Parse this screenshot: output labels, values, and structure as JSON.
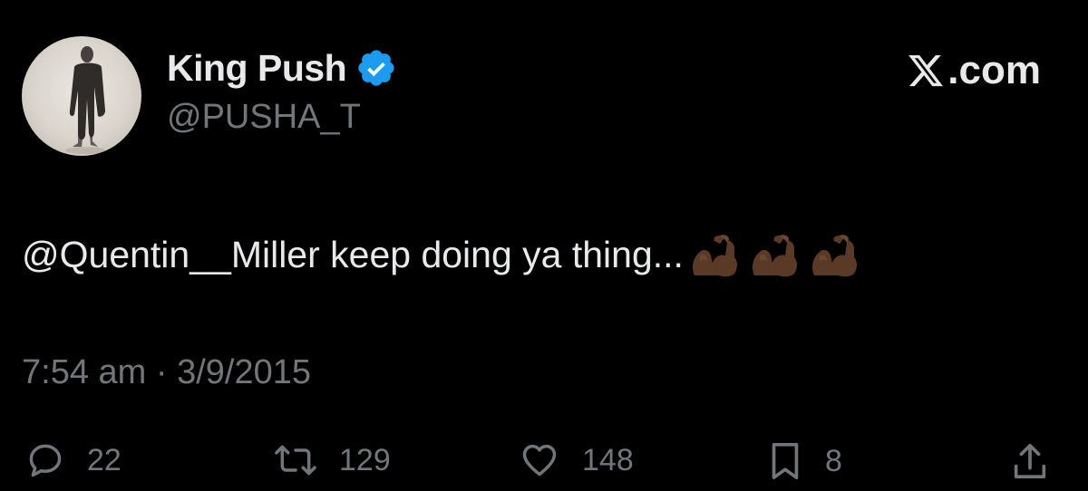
{
  "author": {
    "display_name": "King Push",
    "handle": "@PUSHA_T",
    "verified": true,
    "avatar_icon": "avatar-photo"
  },
  "brand": {
    "logo_icon": "x-logo-icon",
    "text": ".com"
  },
  "tweet": {
    "mention": "@Quentin__Miller",
    "text": " keep doing ya thing...",
    "emojis": [
      "flexed-biceps-dark-skin",
      "flexed-biceps-dark-skin",
      "flexed-biceps-dark-skin"
    ]
  },
  "timestamp": "7:54 am · 3/9/2015",
  "actions": {
    "replies": "22",
    "reposts": "129",
    "likes": "148",
    "bookmarks": "8"
  },
  "colors": {
    "background": "#000000",
    "text": "#e7e9ea",
    "muted": "#71767b",
    "verified_blue": "#1d9bf0"
  }
}
